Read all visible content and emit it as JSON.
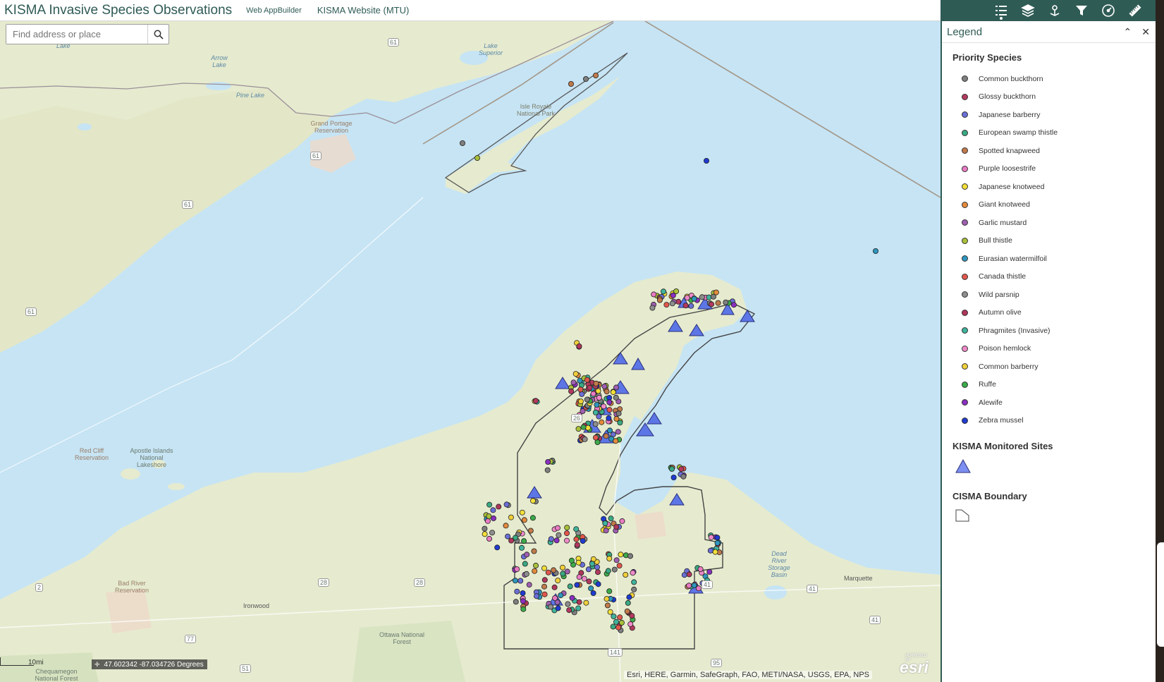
{
  "header": {
    "title": "KISMA Invasive Species Observations",
    "links": [
      "Web AppBuilder",
      "KISMA Website (MTU)"
    ]
  },
  "toolbar": {
    "tools": [
      "legend-list-icon",
      "layers-icon",
      "basemap-pin-icon",
      "filter-icon",
      "dashboard-icon",
      "measure-ruler-icon"
    ]
  },
  "search": {
    "placeholder": "Find address or place"
  },
  "map": {
    "labels": {
      "lake_superior": "Lake Superior",
      "arrow_lake": "Arrow Lake",
      "pine_lake": "Pine Lake",
      "grand_portage": "Grand Portage Reservation",
      "isle_royale": "Isle Royale National Park",
      "red_cliff": "Red Cliff Reservation",
      "apostle_islands": "Apostle Islands National Lakeshore",
      "bad_river": "Bad River Reservation",
      "ironwood": "Ironwood",
      "ottawa_forest": "Ottawa National Forest",
      "chequamegon": "Chequamegon National Forest",
      "dead_river": "Dead River Storage Basin",
      "marquette": "Marquette",
      "lake_top": "Lake"
    },
    "shields": [
      "61",
      "61",
      "61",
      "61",
      "26",
      "41",
      "41",
      "41",
      "28",
      "28",
      "2",
      "77",
      "51",
      "141",
      "95"
    ],
    "scale_label": "10mi",
    "coordinates": "47.602342 -87.034726 Degrees",
    "attribution": "Esri, HERE, Garmin, SafeGraph, FAO, METI/NASA, USGS, EPA, NPS",
    "logo": "esri",
    "logo_small": "POWERED BY"
  },
  "legend": {
    "title": "Legend",
    "layers": [
      {
        "title": "Priority Species",
        "items": [
          {
            "label": "Common buckthorn",
            "color": "#7f7f7f"
          },
          {
            "label": "Glossy buckthorn",
            "color": "#b23a5e"
          },
          {
            "label": "Japanese barberry",
            "color": "#6a6fd6"
          },
          {
            "label": "European swamp thistle",
            "color": "#3aa982"
          },
          {
            "label": "Spotted knapweed",
            "color": "#c07a4a"
          },
          {
            "label": "Purple loosestrife",
            "color": "#e87ac2"
          },
          {
            "label": "Japanese knotweed",
            "color": "#f2de3a"
          },
          {
            "label": "Giant knotweed",
            "color": "#e28a3c"
          },
          {
            "label": "Garlic mustard",
            "color": "#9f5fb0"
          },
          {
            "label": "Bull thistle",
            "color": "#a8c03a"
          },
          {
            "label": "Eurasian watermilfoil",
            "color": "#2e96bd"
          },
          {
            "label": "Canada thistle",
            "color": "#e2574c"
          },
          {
            "label": "Wild parsnip",
            "color": "#8e8e8e"
          },
          {
            "label": "Autumn olive",
            "color": "#b0365a"
          },
          {
            "label": "Phragmites (Invasive)",
            "color": "#3fb39b"
          },
          {
            "label": "Poison hemlock",
            "color": "#ef8ac9"
          },
          {
            "label": "Common barberry",
            "color": "#f0cf3a"
          },
          {
            "label": "Ruffe",
            "color": "#3caa4a"
          },
          {
            "label": "Alewife",
            "color": "#8a2fc0"
          },
          {
            "label": "Zebra mussel",
            "color": "#1f3bd1"
          }
        ]
      },
      {
        "title": "KISMA Monitored Sites",
        "symbol": "triangle",
        "color": "#7d8ff0"
      },
      {
        "title": "CISMA Boundary",
        "symbol": "polygon"
      }
    ]
  }
}
